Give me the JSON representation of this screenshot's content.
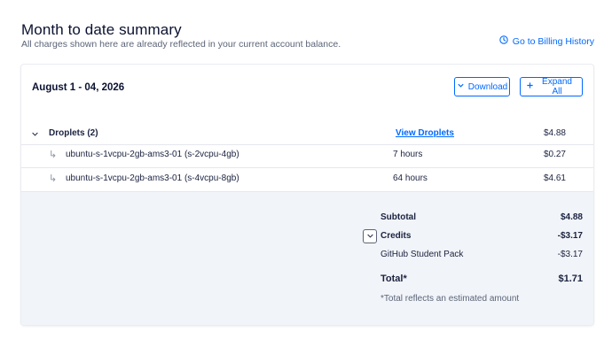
{
  "header": {
    "title": "Month to date summary",
    "subtitle": "All charges shown here are already reflected in your current account balance.",
    "billing_history_link": "Go to Billing History"
  },
  "card": {
    "period": "August 1 - 04, 2026",
    "download_label": "Download",
    "expand_all_label": "Expand All"
  },
  "group": {
    "label": "Droplets (2)",
    "link": "View Droplets",
    "amount": "$4.88",
    "items": [
      {
        "name": "ubuntu-s-1vcpu-2gb-ams3-01 (s-2vcpu-4gb)",
        "duration": "7 hours",
        "amount": "$0.27"
      },
      {
        "name": "ubuntu-s-1vcpu-2gb-ams3-01 (s-4vcpu-8gb)",
        "duration": "64 hours",
        "amount": "$4.61"
      }
    ]
  },
  "summary": {
    "subtotal_label": "Subtotal",
    "subtotal_value": "$4.88",
    "credits_label": "Credits",
    "credits_value": "-$3.17",
    "pack_label": "GitHub Student Pack",
    "pack_value": "-$3.17",
    "total_label": "Total*",
    "total_value": "$1.71",
    "footnote": "*Total reflects an estimated amount"
  },
  "colors": {
    "accent": "#0069ff",
    "summary_bg": "#f1f4f8",
    "text": "#1b2240"
  }
}
